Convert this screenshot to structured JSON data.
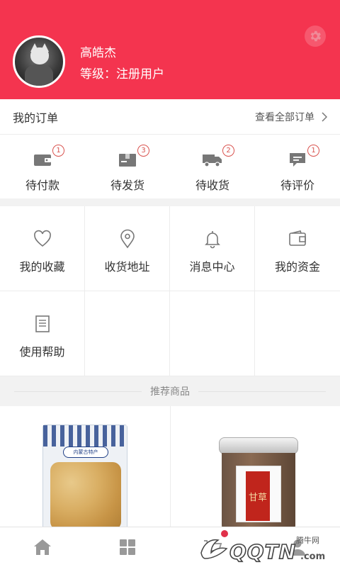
{
  "profile": {
    "name": "高皓杰",
    "level": "等级：注册用户"
  },
  "orders": {
    "title": "我的订单",
    "view_all": "查看全部订单",
    "items": [
      {
        "label": "待付款",
        "badge": "1",
        "icon": "wallet-icon"
      },
      {
        "label": "待发货",
        "badge": "3",
        "icon": "package-icon"
      },
      {
        "label": "待收货",
        "badge": "2",
        "icon": "truck-icon"
      },
      {
        "label": "待评价",
        "badge": "1",
        "icon": "comment-icon"
      }
    ]
  },
  "grid": {
    "items": [
      {
        "label": "我的收藏",
        "icon": "heart-icon"
      },
      {
        "label": "收货地址",
        "icon": "location-pin-icon"
      },
      {
        "label": "消息中心",
        "icon": "bell-icon"
      },
      {
        "label": "我的资金",
        "icon": "wallet-outline-icon"
      },
      {
        "label": "使用帮助",
        "icon": "document-icon"
      }
    ]
  },
  "recommend": {
    "title": "推荐商品",
    "products": [
      {
        "package_text": "内蒙古特产"
      },
      {
        "package_text": "甘草"
      }
    ]
  },
  "tabbar": {
    "items": [
      {
        "icon": "home-icon"
      },
      {
        "icon": "category-icon"
      },
      {
        "icon": "cart-icon"
      },
      {
        "icon": "user-icon"
      }
    ]
  },
  "watermark": {
    "small": "腾牛网",
    "big": "QQTN",
    "url": ".com"
  },
  "colors": {
    "primary": "#f4344f",
    "badge": "#d9534f",
    "icon_gray": "#777777"
  }
}
